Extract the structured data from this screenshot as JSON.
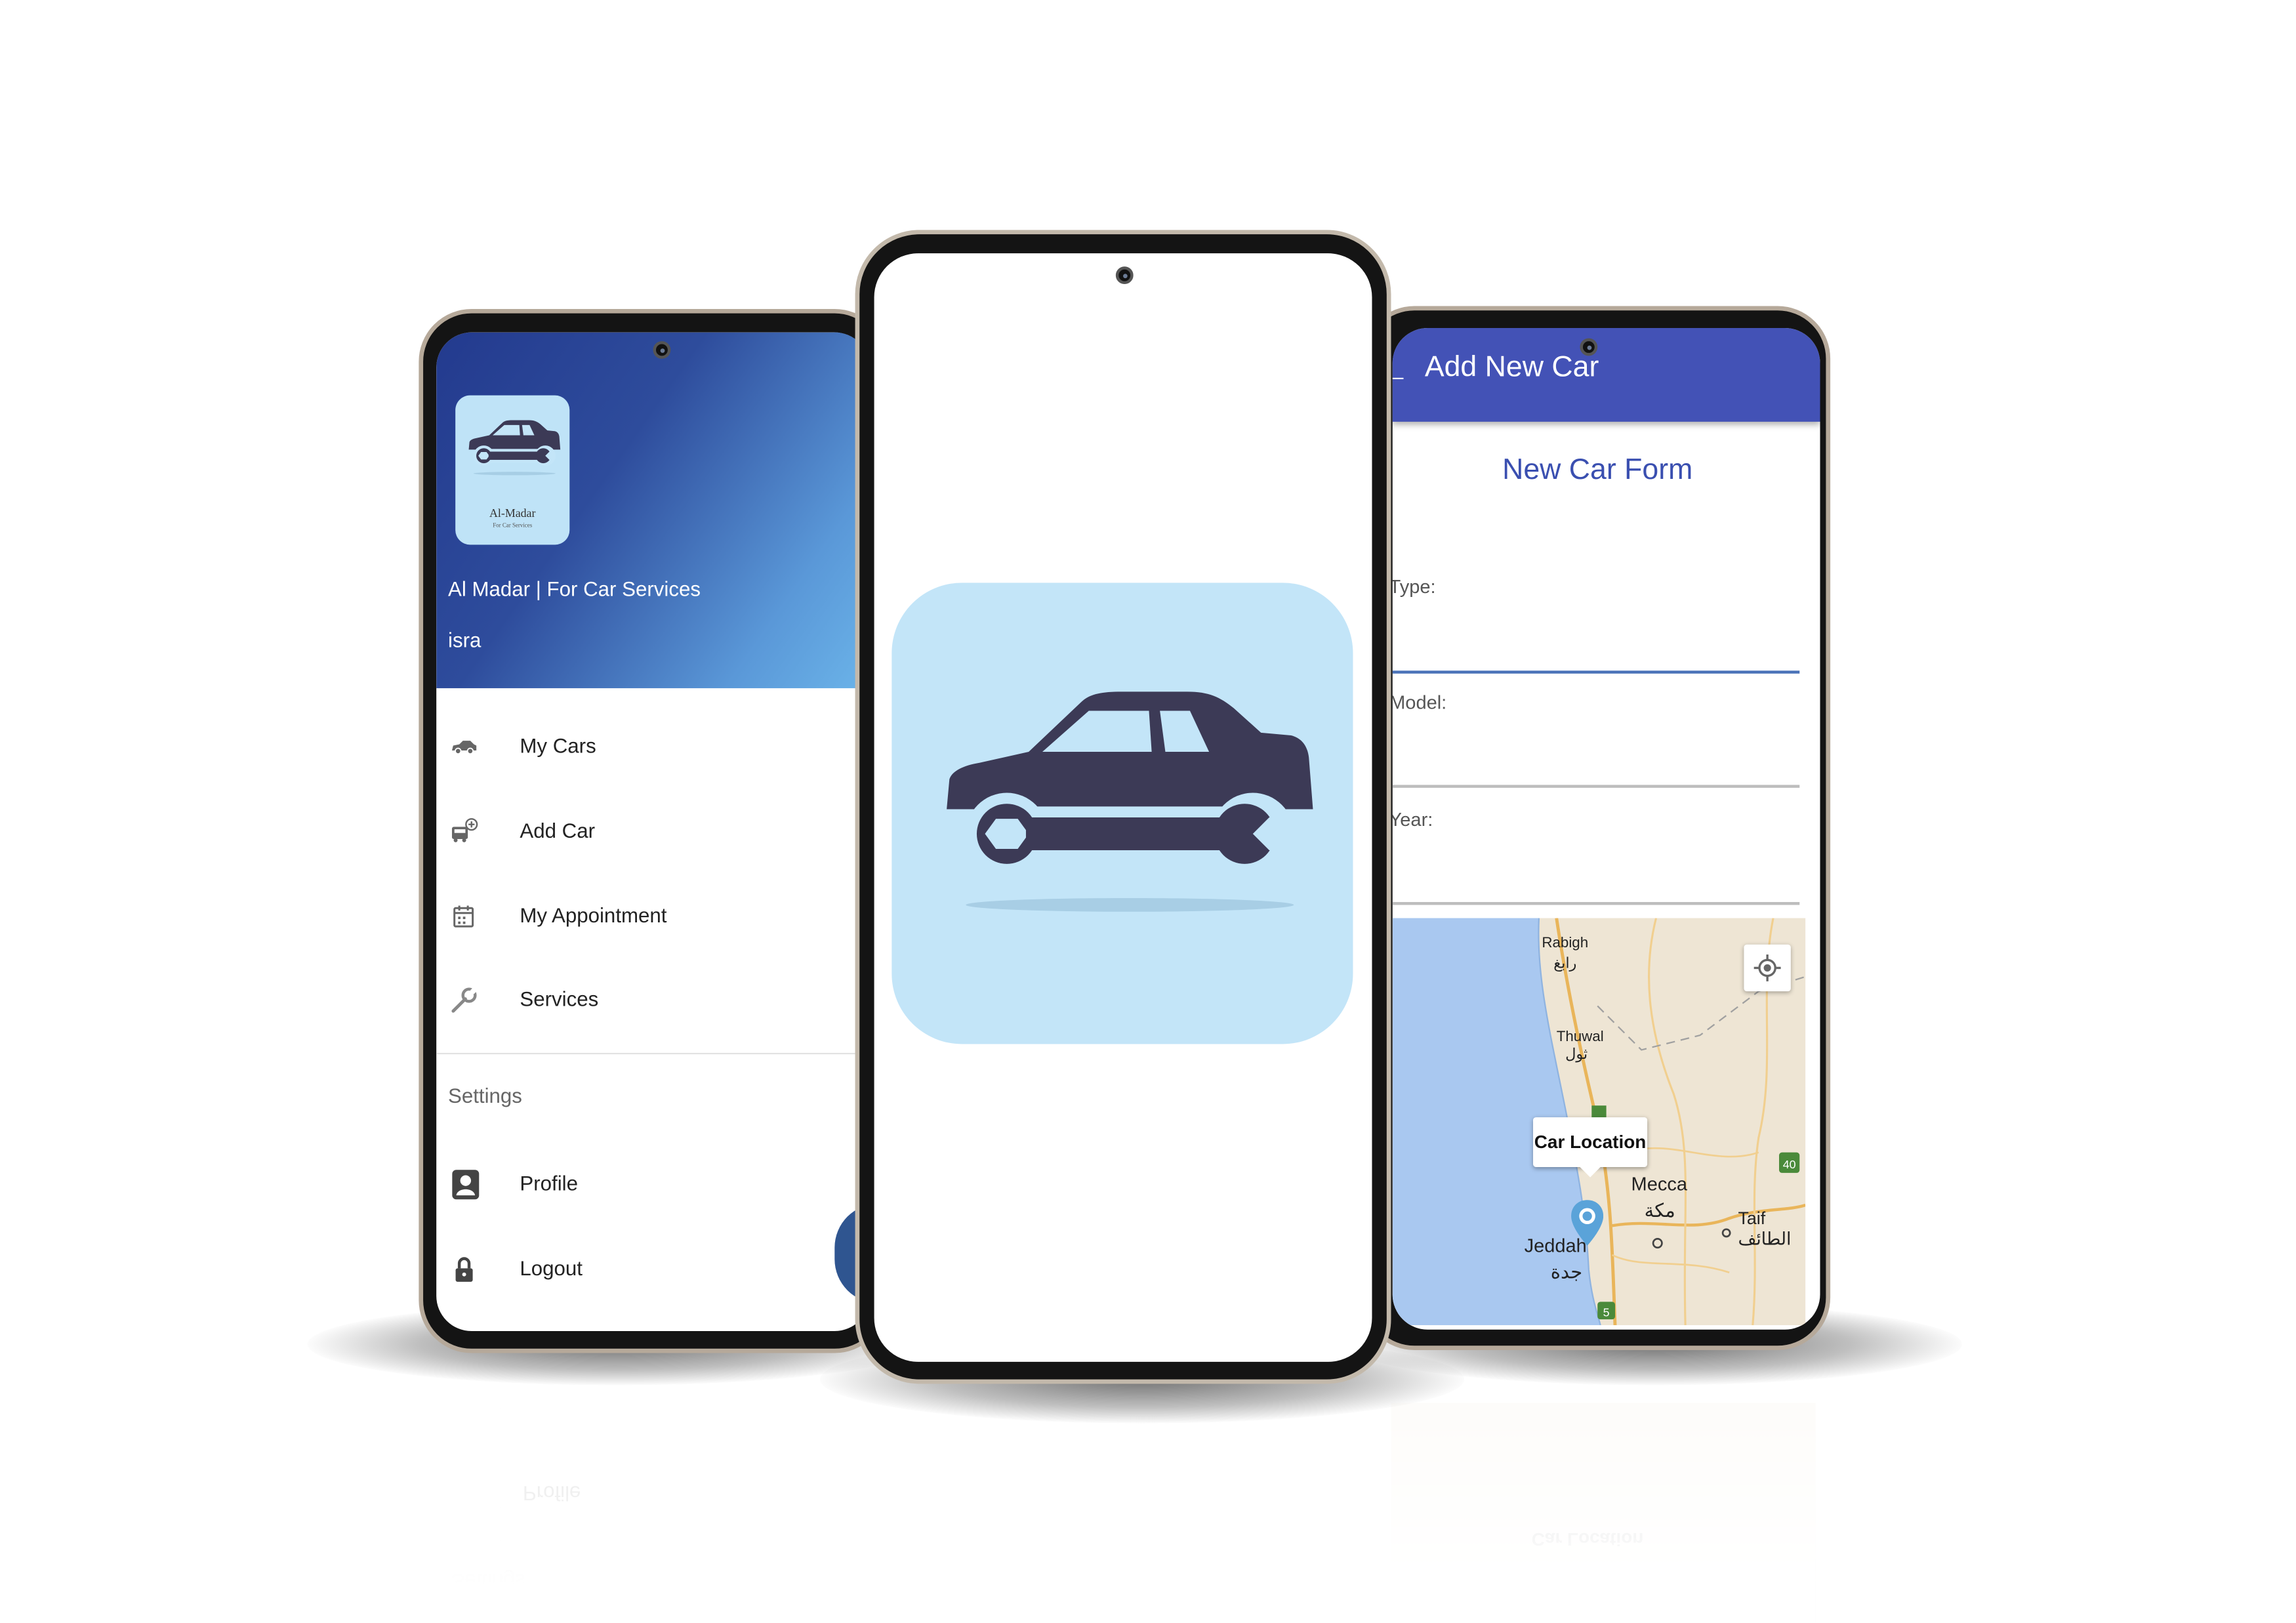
{
  "drawer": {
    "app_name": "Al Madar | For Car Services",
    "user": "isra",
    "logo_text": "Al-Madar",
    "logo_subtext": "For Car Services",
    "items": [
      {
        "label": "My Cars",
        "icon": "car-icon"
      },
      {
        "label": "Add Car",
        "icon": "add-car-icon"
      },
      {
        "label": "My Appointment",
        "icon": "calendar-icon"
      },
      {
        "label": "Services",
        "icon": "wrench-icon"
      }
    ],
    "settings_heading": "Settings",
    "settings_items": [
      {
        "label": "Profile",
        "icon": "profile-icon"
      },
      {
        "label": "Logout",
        "icon": "lock-icon"
      }
    ]
  },
  "splash": {
    "icon": "car-wrench-logo-icon"
  },
  "add_car": {
    "title": "Add New Car",
    "form_title": "New Car Form",
    "fields": [
      {
        "label": "r Type:"
      },
      {
        "label": "r Model:"
      },
      {
        "label": "r Year:"
      }
    ],
    "map": {
      "marker_label": "Car Location",
      "places": [
        "Rabigh",
        "رابغ",
        "Thuwal",
        "ثول",
        "Mecca",
        "مكة",
        "Jeddah",
        "جدة",
        "Taif",
        "الطائف"
      ],
      "road_shields": [
        "40",
        "5"
      ]
    }
  },
  "colors": {
    "drawer_header_start": "#233a8e",
    "drawer_header_end": "#6ab2e8",
    "app_bar": "#4352b6",
    "form_title": "#3a4fb0",
    "logo_background": "#c3e5f8",
    "logo_foreground": "#3c3a56"
  }
}
